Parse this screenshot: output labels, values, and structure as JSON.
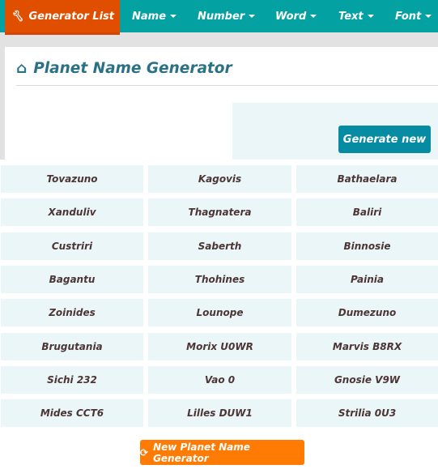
{
  "nav": {
    "generator_list": "Generator List",
    "items": [
      "Name",
      "Number",
      "Word",
      "Text",
      "Font"
    ]
  },
  "page_title": "Planet Name Generator",
  "generate_label": "Generate new",
  "names": [
    [
      "Tovazuno",
      "Kagovis",
      "Bathaelara"
    ],
    [
      "Xanduliv",
      "Thagnatera",
      "Baliri"
    ],
    [
      "Custriri",
      "Saberth",
      "Binnosie"
    ],
    [
      "Bagantu",
      "Thohines",
      "Painia"
    ],
    [
      "Zoinides",
      "Lounope",
      "Dumezuno"
    ],
    [
      "Brugutania",
      "Morix U0WR",
      "Marvis B8RX"
    ],
    [
      "Sichi 232",
      "Vao 0",
      "Gnosie V9W"
    ],
    [
      "Mides CCT6",
      "Lilles DUW1",
      "Strilia 0U3"
    ]
  ],
  "new_generator_label": "New Planet Name Generator",
  "colors": {
    "nav": "#04a1a3",
    "active": "#e04f00",
    "button": "#068ca2",
    "orange": "#ff7b04"
  }
}
